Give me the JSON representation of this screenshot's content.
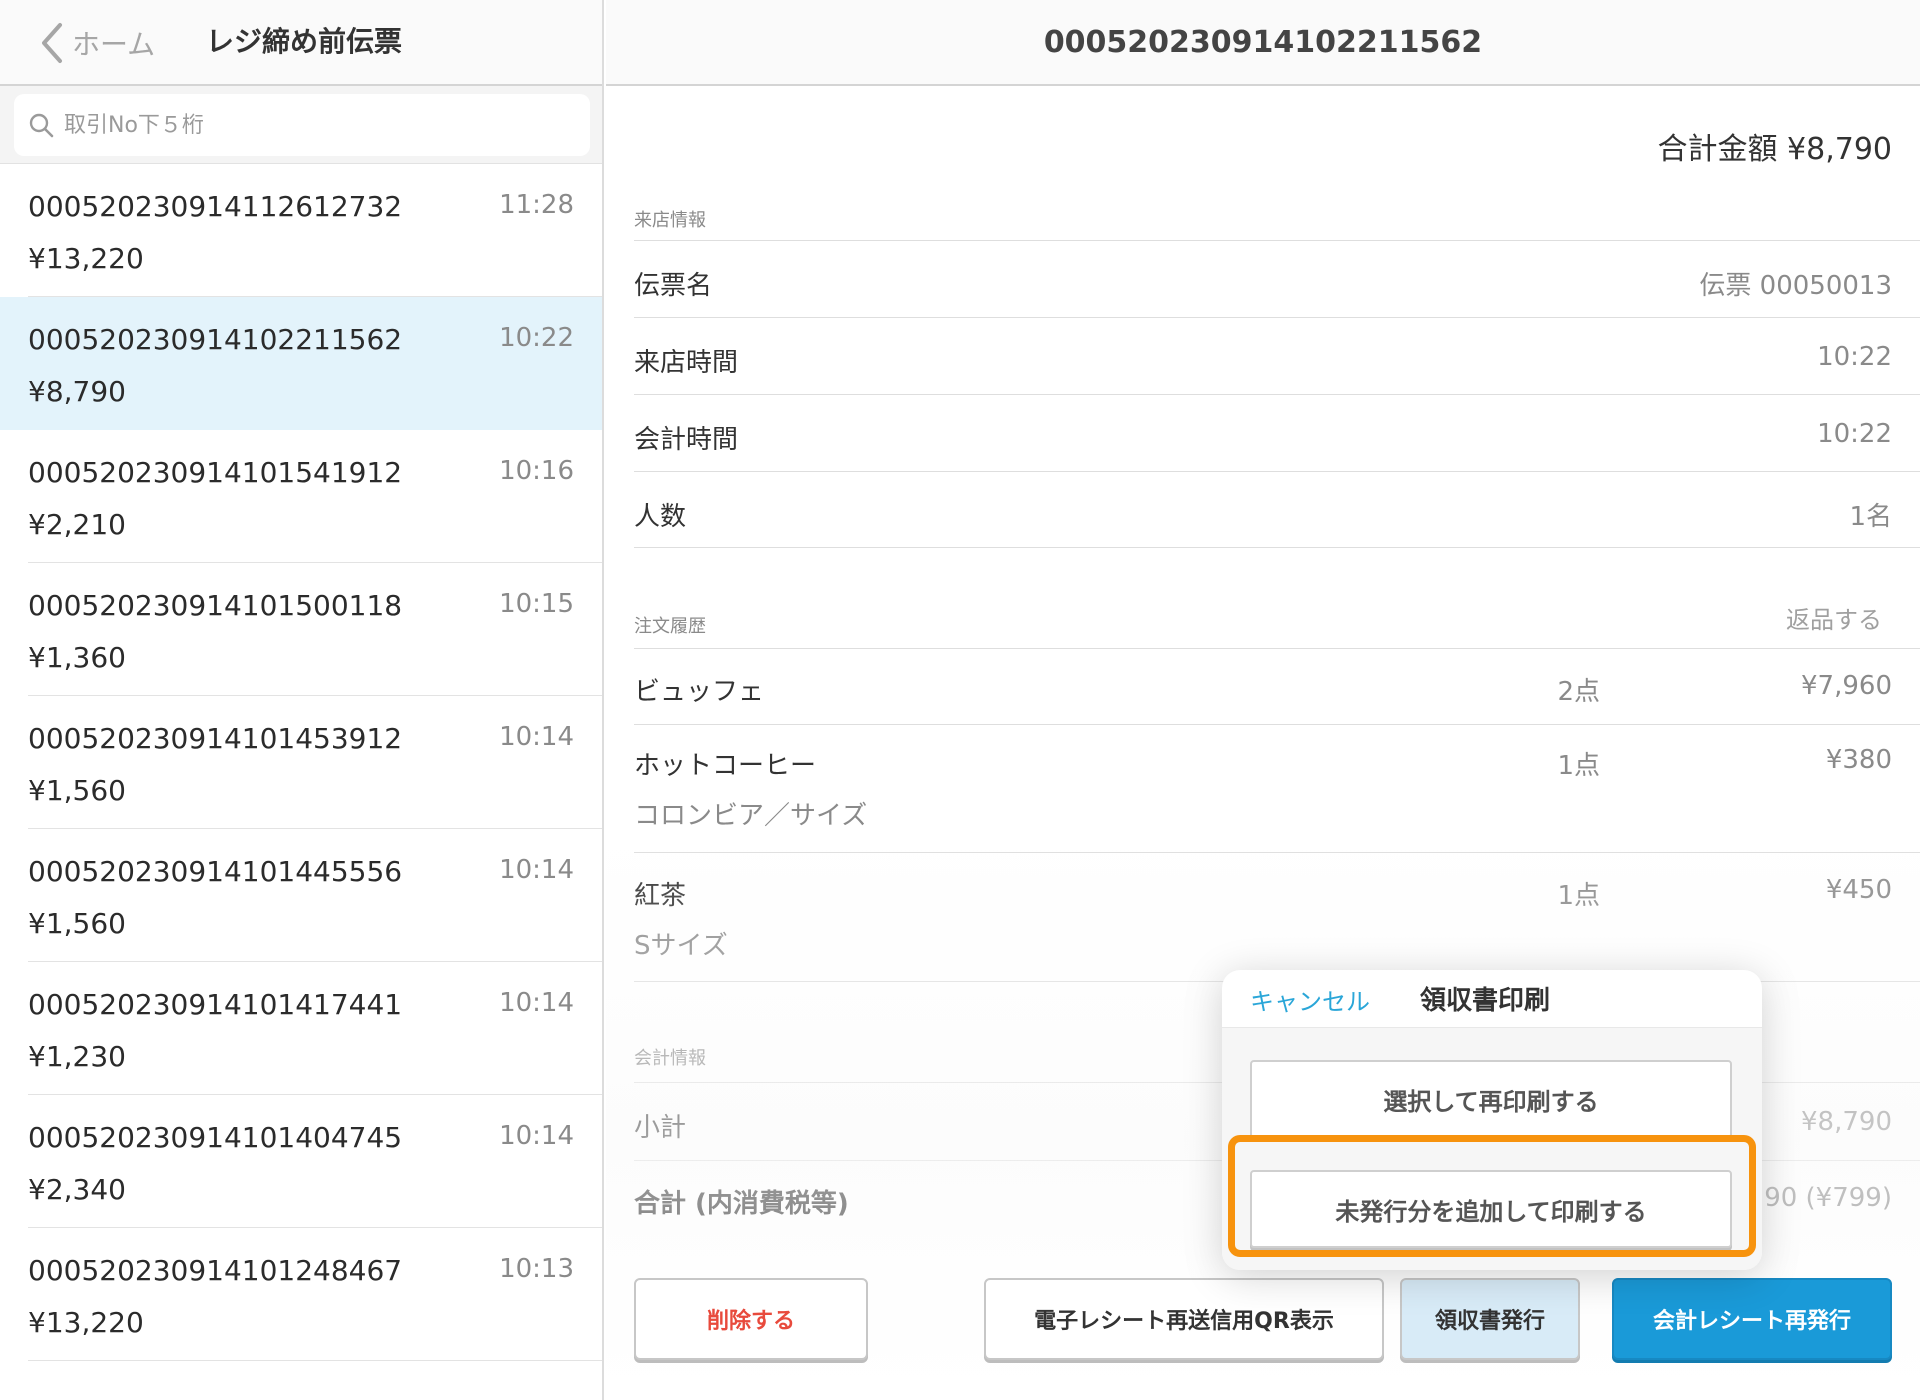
{
  "left": {
    "back_label": "ホーム",
    "title": "レジ締め前伝票",
    "search_placeholder": "取引No下５桁",
    "transactions": [
      {
        "no": "00052023091411261273​2",
        "amount": "¥13,220",
        "time": "11:28"
      },
      {
        "no": "000520230914102211562",
        "amount": "¥8,790",
        "time": "10:22"
      },
      {
        "no": "000520230914101541912",
        "amount": "¥2,210",
        "time": "10:16"
      },
      {
        "no": "000520230914101500118",
        "amount": "¥1,360",
        "time": "10:15"
      },
      {
        "no": "000520230914101453912",
        "amount": "¥1,560",
        "time": "10:14"
      },
      {
        "no": "000520230914101445556",
        "amount": "¥1,560",
        "time": "10:14"
      },
      {
        "no": "000520230914101417441",
        "amount": "¥1,230",
        "time": "10:14"
      },
      {
        "no": "000520230914101404745",
        "amount": "¥2,340",
        "time": "10:14"
      },
      {
        "no": "000520230914101248467",
        "amount": "¥13,220",
        "time": "10:13"
      }
    ]
  },
  "right": {
    "title": "000520230914102211562",
    "total_label": "合計金額 ¥8,790",
    "visit_section": "来店情報",
    "visit_rows": [
      {
        "label": "伝票名",
        "value": "伝票 00050013"
      },
      {
        "label": "来店時間",
        "value": "10:22"
      },
      {
        "label": "会計時間",
        "value": "10:22"
      },
      {
        "label": "人数",
        "value": "1名"
      }
    ],
    "order_section": "注文履歴",
    "return_label": "返品する",
    "orders": [
      {
        "name": "ビュッフェ",
        "sub": "",
        "qty": "2点",
        "price": "¥7,960"
      },
      {
        "name": "ホットコーヒー",
        "sub": "コロンビア／サイズ",
        "qty": "1点",
        "price": "¥380"
      },
      {
        "name": "紅茶",
        "sub": "Sサイズ",
        "qty": "1点",
        "price": "¥450"
      }
    ],
    "payment_section": "会計情報",
    "subtotal_label": "小計",
    "subtotal_value": "¥8,790",
    "total_tax_label": "合計 (内消費税等)",
    "total_tax_value": "90 (¥799)",
    "buttons": {
      "delete": "削除する",
      "qr": "電子レシート再送信用QR表示",
      "receipt": "領収書発行",
      "reissue": "会計レシート再発行"
    }
  },
  "popover": {
    "cancel": "キャンセル",
    "title": "領収書印刷",
    "option_reprint": "選択して再印刷する",
    "option_add_print": "未発行分を追加して印刷する"
  },
  "colors": {
    "accent": "#1a9ad8",
    "selected_row": "#e3f3fb",
    "highlight": "#f7930e",
    "delete": "#e84a3c"
  }
}
